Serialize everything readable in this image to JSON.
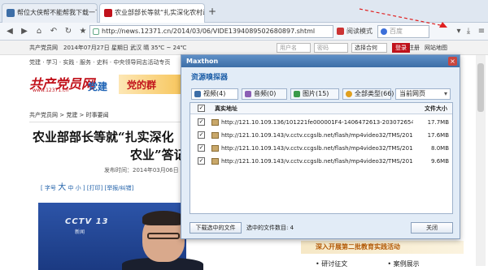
{
  "tabs": [
    {
      "title": "帮位大侠帮不能帮我下载一下这...",
      "active": false
    },
    {
      "title": "农业部部长等就“扎实深化农村改...",
      "active": true
    }
  ],
  "new_tab_label": "+",
  "nav": {
    "url": "http://news.12371.cn/2014/03/06/VIDE1394089502680897.shtml",
    "reader_label": "阅读模式",
    "search_placeholder": "百度"
  },
  "sitebar": {
    "site_name": "共产党员网",
    "date_text": "2014年07月27日 星期日 武汉 晴 35℃ ~ 24℃",
    "username_placeholder": "用户名",
    "password_placeholder": "密码",
    "select_label": "选择合何",
    "login_label": "登录",
    "register_label": "注册",
    "nav_label": "网站地图"
  },
  "subnav": "党建 · 学习 · 实践 · 服务 · 史料 · 中央领导同志活动专页",
  "logo": {
    "text": "共产党员网",
    "url_text": "www.12371.cn",
    "party": "党建",
    "banner": "党的群"
  },
  "breadcrumb": "共产党员网 > 党建 > 时事要闻",
  "article": {
    "headline_line1": "农业部部长等就“扎实深化",
    "headline_line2": "农业”答记",
    "pubtime": "发布时间：2014年03月06日",
    "tools_prefix": "[ 字号",
    "tools_big": "大",
    "tools_mid": "中",
    "tools_small": "小",
    "tools_rest": "] [打印] [举报/纠错]"
  },
  "video": {
    "channel": "CCTV 13",
    "channel_sub": "新闻"
  },
  "side": {
    "banner": "深入开展第二批教育实践活动",
    "link1": "• 研讨征文",
    "link2": "• 案例展示"
  },
  "dialog": {
    "title": "Maxthon",
    "close": "×",
    "subtitle": "资源嗅探器",
    "tabs": [
      {
        "label": "视频(4)",
        "color": "#3d6ea7"
      },
      {
        "label": "音频(0)",
        "color": "#8b5fb5"
      },
      {
        "label": "图片(15)",
        "color": "#3a9a4a"
      },
      {
        "label": "全部类型(66)",
        "color": "#e0a020"
      }
    ],
    "scope_select": "当前网页",
    "col_url": "真实地址",
    "col_size": "文件大小",
    "rows": [
      {
        "url": "http://121.10.109.136/101221fe000001F4-1406472613-2030726543/data11/v.c...",
        "size": "17.7MB",
        "checked": "✓"
      },
      {
        "url": "http://121.10.109.143/v.cctv.ccgslb.net/flash/mp4video32/TMS/2014/03/06/24b...",
        "size": "17.6MB",
        "checked": "✓"
      },
      {
        "url": "http://121.10.109.143/v.cctv.ccgslb.net/flash/mp4video32/TMS/2014/03/06/24b...",
        "size": "8.0MB",
        "checked": "✓"
      },
      {
        "url": "http://121.10.109.143/v.cctv.ccgslb.net/flash/mp4video32/TMS/2014/03/06/24b...",
        "size": "9.6MB",
        "checked": "✓"
      }
    ],
    "header_checked": "✓",
    "download_button": "下载选中的文件",
    "selected_count": "选中的文件数目: 4",
    "close_button": "关闭"
  }
}
